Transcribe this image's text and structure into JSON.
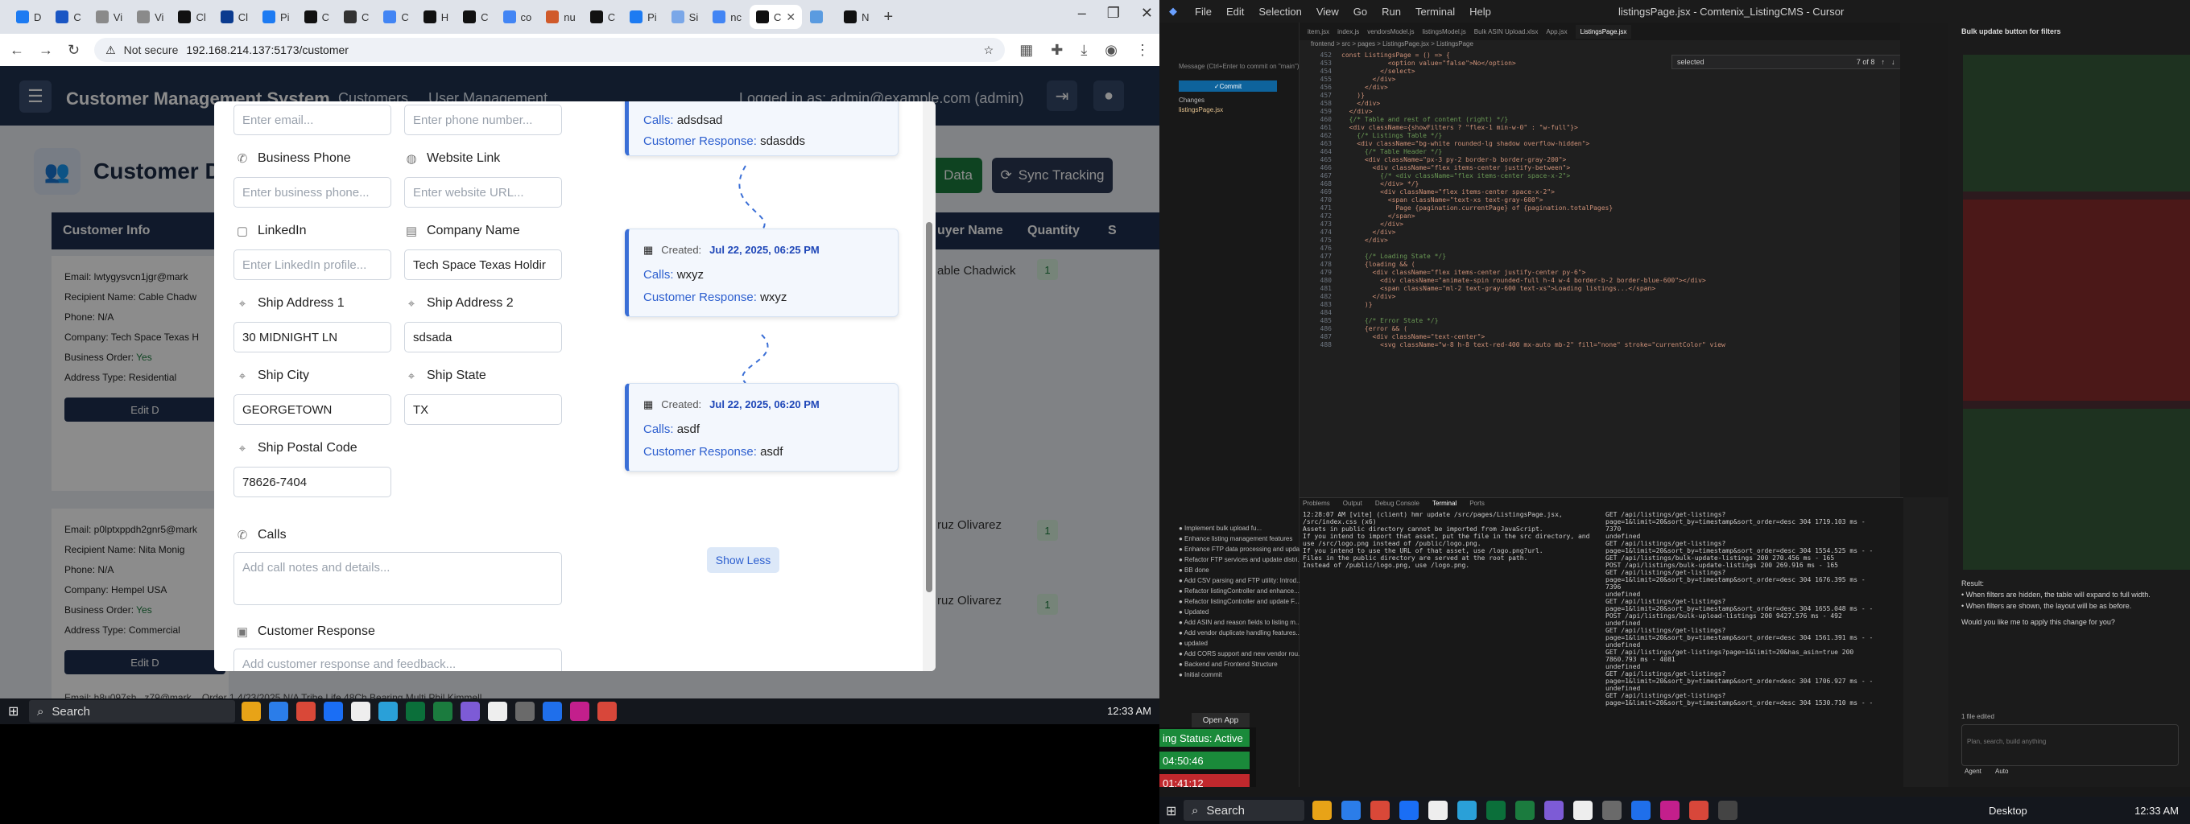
{
  "browser": {
    "tabs": [
      {
        "label": "D",
        "color": "#1d7bf2"
      },
      {
        "label": "C",
        "color": "#1a56c4"
      },
      {
        "label": "Vi",
        "color": "#8a8a8a"
      },
      {
        "label": "Vi",
        "color": "#8a8a8a"
      },
      {
        "label": "Cl",
        "color": "#111111"
      },
      {
        "label": "Cl",
        "color": "#0b3b8f"
      },
      {
        "label": "Pi",
        "color": "#1d7bf2"
      },
      {
        "label": "C",
        "color": "#111111"
      },
      {
        "label": "C",
        "color": "#333333"
      },
      {
        "label": "C",
        "color": "#4285f4"
      },
      {
        "label": "H",
        "color": "#111111"
      },
      {
        "label": "C",
        "color": "#111111"
      },
      {
        "label": "co",
        "color": "#4285f4"
      },
      {
        "label": "nu",
        "color": "#d05a2a"
      },
      {
        "label": "C",
        "color": "#111111"
      },
      {
        "label": "Pi",
        "color": "#1d7bf2"
      },
      {
        "label": "Si",
        "color": "#7aa7e8"
      },
      {
        "label": "nc",
        "color": "#4285f4"
      },
      {
        "label": "C",
        "color": "#111111",
        "active": true
      },
      {
        "label": "",
        "color": "#5a9be0"
      },
      {
        "label": "N",
        "color": "#111111"
      }
    ],
    "url": "192.168.214.137:5173/customer",
    "not_secure": "Not secure"
  },
  "app": {
    "title": "Customer Management System",
    "nav_customers": "Customers",
    "nav_users": "User Management",
    "logged_in": "Logged in as: admin@example.com (admin)",
    "dashboard_title": "Customer Da",
    "btn_data": "Data",
    "btn_sync": "Sync Tracking",
    "col_customer_info": "Customer Info",
    "col_buyer_name": "uyer Name",
    "col_quantity": "Quantity",
    "col_s": "S"
  },
  "rows": [
    {
      "email": "Email: lwtygysvcn1jgr@mark",
      "recipient": "Recipient Name: Cable Chadw",
      "phone": "Phone: N/A",
      "company": "Company: Tech Space Texas H",
      "business": "Business Order: ",
      "business_val": "Yes",
      "address": "Address Type: Residential",
      "edit": "Edit D",
      "buyer": "able Chadwick",
      "qty": "1"
    },
    {
      "email": "Email: p0lptxppdh2gnr5@mark",
      "recipient": "Recipient Name: Nita Monig",
      "phone": "Phone: N/A",
      "company": "Company: Hempel USA",
      "business": "Business Order: ",
      "business_val": "Yes",
      "address": "Address Type: Commercial",
      "edit": "Edit D",
      "buyer": "ruz Olivarez",
      "qty": "1"
    },
    {
      "buyer": "ruz Olivarez",
      "qty": "1"
    },
    {
      "bottom_text": "Email: h8u097sh...z79@mark...  Order 1  4/23/2025  N/A  Tribe Life 48Ch Bearing Multi  Phil Kimmell"
    }
  ],
  "modal": {
    "email_ph": "Enter email...",
    "phone_ph": "Enter phone number...",
    "business_phone_label": "Business Phone",
    "business_phone_ph": "Enter business phone...",
    "website_label": "Website Link",
    "website_ph": "Enter website URL...",
    "linkedin_label": "LinkedIn",
    "linkedin_ph": "Enter LinkedIn profile...",
    "company_label": "Company Name",
    "company_val": "Tech Space Texas Holdir",
    "ship1_label": "Ship Address 1",
    "ship1_val": "30 MIDNIGHT LN",
    "ship2_label": "Ship Address 2",
    "ship2_val": "sdsada",
    "city_label": "Ship City",
    "city_val": "GEORGETOWN",
    "state_label": "Ship State",
    "state_val": "TX",
    "postal_label": "Ship Postal Code",
    "postal_val": "78626-7404",
    "calls_label": "Calls",
    "calls_ph": "Add call notes and details...",
    "response_label": "Customer Response",
    "response_ph": "Add customer response and feedback...",
    "timeline": [
      {
        "calls_k": "Calls:",
        "calls": "adsdsad",
        "resp_k": "Customer Response:",
        "resp": "sdasdds"
      },
      {
        "created_k": "Created:",
        "created": "Jul 22, 2025, 06:25 PM",
        "calls_k": "Calls:",
        "calls": "wxyz",
        "resp_k": "Customer Response:",
        "resp": "wxyz"
      },
      {
        "created_k": "Created:",
        "created": "Jul 22, 2025, 06:20 PM",
        "calls_k": "Calls:",
        "calls": "asdf",
        "resp_k": "Customer Response:",
        "resp": "asdf"
      }
    ],
    "show_less": "Show Less"
  },
  "taskbar": {
    "search": "Search",
    "time": "12:33 AM"
  },
  "vscode": {
    "menu": [
      "File",
      "Edit",
      "Selection",
      "View",
      "Go",
      "Run",
      "Terminal",
      "Help"
    ],
    "window_title": "listingsPage.jsx - Comtenix_ListingCMS - Cursor",
    "tabs": [
      "item.jsx",
      "index.js",
      "vendorsModel.js",
      "listingsModel.js",
      "Bulk ASIN Upload.xlsx",
      "App.jsx",
      "ListingsPage.jsx"
    ],
    "breadcrumb": "frontend > src > pages > ListingsPage.jsx > ListingsPage",
    "find_query": "selected",
    "find_count": "7 of 8",
    "commit": "Commit",
    "changes": "Changes",
    "changed_file": "listingsPage.jsx",
    "graph_items": [
      "Implement bulk upload fu...",
      "Enhance listing management features",
      "Enhance FTP data processing and upda...",
      "Refactor FTP services and update distri...",
      "BB done",
      "Add CSV parsing and FTP utility: Introd...",
      "Refactor listingController and enhance...",
      "Refactor listingController and update F...",
      "Updated",
      "Add ASIN and reason fields to listing m...",
      "Add vendor duplicate handling features...",
      "updated",
      "Add CORS support and new vendor rou...",
      "Backend and Frontend Structure",
      "Initial commit"
    ],
    "code_lines": [
      "const ListingsPage = () => {",
      "            <option value=\"false\">No</option>",
      "          </select>",
      "        </div>",
      "      </div>",
      "    )}",
      "    </div>",
      "  </div>",
      "  {/* Table and rest of content (right) */}",
      "  <div className={showFilters ? \"flex-1 min-w-0\" : \"w-full\"}>",
      "    {/* Listings Table */}",
      "    <div className=\"bg-white rounded-lg shadow overflow-hidden\">",
      "      {/* Table Header */}",
      "      <div className=\"px-3 py-2 border-b border-gray-200\">",
      "        <div className=\"flex items-center justify-between\">",
      "          {/* <div className=\"flex items-center space-x-2\">",
      "          </div> */}",
      "          <div className=\"flex items-center space-x-2\">",
      "            <span className=\"text-xs text-gray-600\">",
      "              Page {pagination.currentPage} of {pagination.totalPages}",
      "            </span>",
      "          </div>",
      "        </div>",
      "      </div>",
      "",
      "      {/* Loading State */}",
      "      {loading && (",
      "        <div className=\"flex items-center justify-center py-6\">",
      "          <div className=\"animate-spin rounded-full h-4 w-4 border-b-2 border-blue-600\"></div>",
      "          <span className=\"ml-2 text-gray-600 text-xs\">Loading listings...</span>",
      "        </div>",
      "      )}",
      "",
      "      {/* Error State */}",
      "      {error && (",
      "        <div className=\"text-center\">",
      "          <svg className=\"w-8 h-8 text-red-400 mx-auto mb-2\" fill=\"none\" stroke=\"currentColor\" view"
    ],
    "terminal_left": [
      "12:28:07 AM [vite] (client) hmr update /src/pages/ListingsPage.jsx, /src/index.css (x6)",
      "Assets in public directory cannot be imported from JavaScript.",
      "If you intend to import that asset, put the file in the src directory, and use /src/logo.png instead of /public/logo.png.",
      "If you intend to use the URL of that asset, use /logo.png?url.",
      "Files in the public directory are served at the root path.",
      "Instead of /public/logo.png, use /logo.png."
    ],
    "terminal_right": [
      "GET /api/listings/get-listings?page=1&limit=20&sort_by=timestamp&sort_order=desc 304 1719.103 ms - 7370",
      "undefined",
      "GET /api/listings/get-listings?page=1&limit=20&sort_by=timestamp&sort_order=desc 304 1554.525 ms - -",
      "GET /api/listings/bulk-update-listings 200 270.456 ms - 165",
      "POST /api/listings/bulk-update-listings 200 269.916 ms - 165",
      "GET /api/listings/get-listings?page=1&limit=20&sort_by=timestamp&sort_order=desc 304 1676.395 ms - 7396",
      "undefined",
      "GET /api/listings/get-listings?page=1&limit=20&sort_by=timestamp&sort_order=desc 304 1655.048 ms - -",
      "POST /api/listings/bulk-upload-listings 200 9427.576 ms - 492",
      "undefined",
      "GET /api/listings/get-listings?page=1&limit=20&sort_by=timestamp&sort_order=desc 304 1561.391 ms - -",
      "undefined",
      "GET /api/listings/get-listings?page=1&limit=20&has_asin=true 200 7860.793 ms - 4081",
      "undefined",
      "GET /api/listings/get-listings?page=1&limit=20&sort_by=timestamp&sort_order=desc 304 1706.927 ms - -",
      "undefined",
      "GET /api/listings/get-listings?page=1&limit=20&sort_by=timestamp&sort_order=desc 304 1530.710 ms - -"
    ],
    "chat_title": "Bulk update button for filters",
    "chat_result": "Result:",
    "chat_bullet1": "When filters are hidden, the table will expand to full width.",
    "chat_bullet2": "When filters are shown, the layout will be as before.",
    "chat_question": "Would you like me to apply this change for you?",
    "chat_input_ph": "Plan, search, build anything",
    "chat_agent": "Agent",
    "chat_auto": "Auto",
    "files_edited": "1 file edited",
    "open_app": "Open App"
  },
  "status_side": {
    "status": "ing Status: Active",
    "t1": "04:50:46",
    "t2": "01:41:12",
    "c1": "#1a8a3a",
    "c2": "#1a8a3a",
    "c3": "#c0282d"
  },
  "taskbar_r": {
    "search": "Search",
    "desktop": "Desktop",
    "time": "12:33 AM"
  }
}
